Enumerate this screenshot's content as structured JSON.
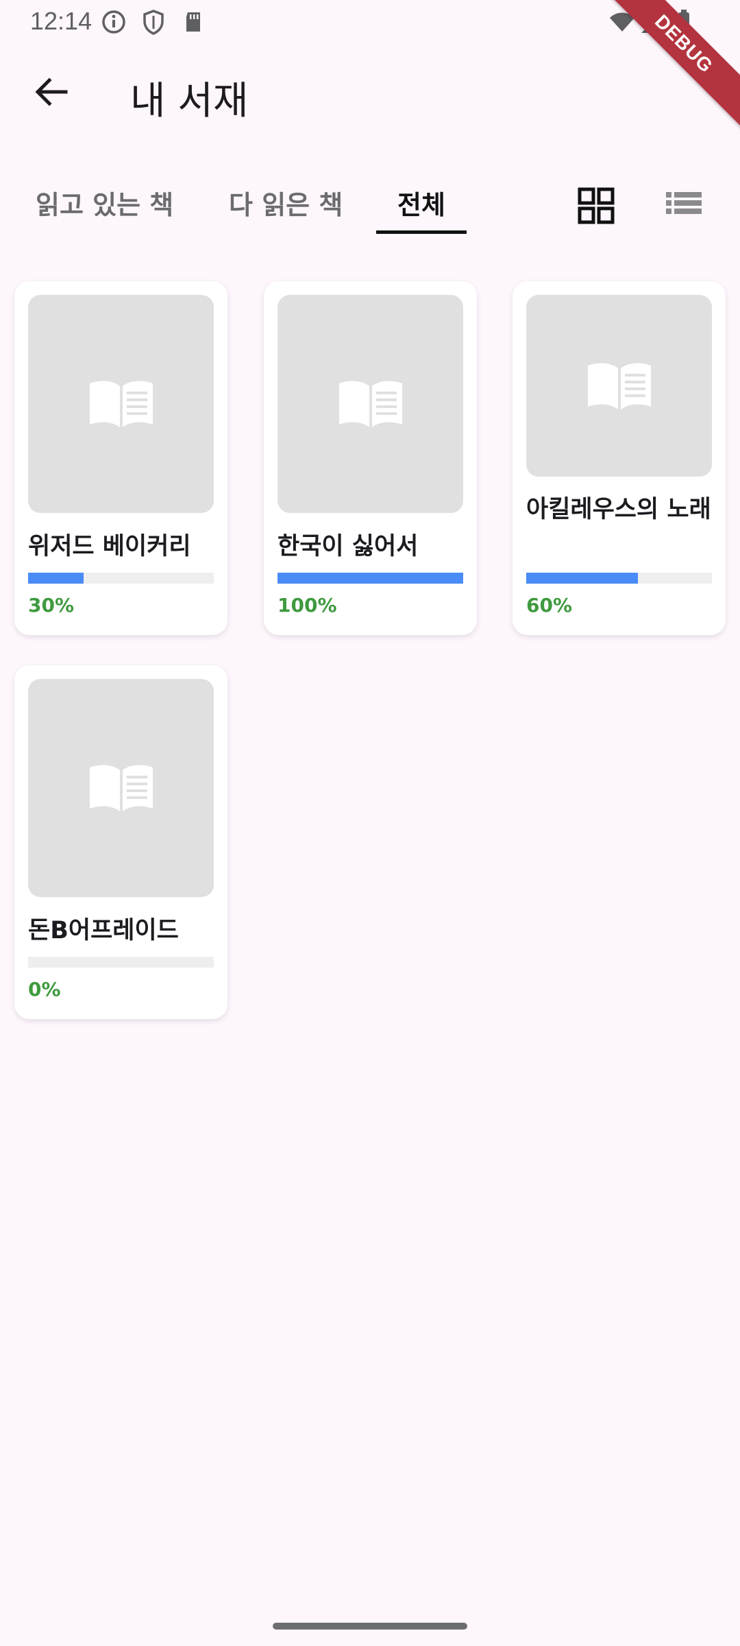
{
  "status_bar": {
    "time": "12:14"
  },
  "debug_banner": "DEBUG",
  "app_bar": {
    "title": "내 서재"
  },
  "tabs": [
    {
      "label": "읽고 있는 책"
    },
    {
      "label": "다 읽은 책"
    },
    {
      "label": "전체"
    }
  ],
  "active_tab": "전체",
  "icons": {
    "back": "arrow-left-icon",
    "grid_view": "grid-view-icon",
    "list_view": "list-view-icon",
    "book_placeholder": "open-book-icon"
  },
  "colors": {
    "progress": "#4a8cf7",
    "percent": "#3f9a3f",
    "background": "#fdf6fc"
  },
  "books": [
    {
      "title": "위저드 베이커리",
      "percent_label": "30%",
      "progress": 0.3
    },
    {
      "title": "한국이 싫어서",
      "percent_label": "100%",
      "progress": 1.0
    },
    {
      "title": "아킬레우스의 노래",
      "percent_label": "60%",
      "progress": 0.6
    },
    {
      "title": "돈B어프레이드",
      "percent_label": "0%",
      "progress": 0.0
    }
  ]
}
